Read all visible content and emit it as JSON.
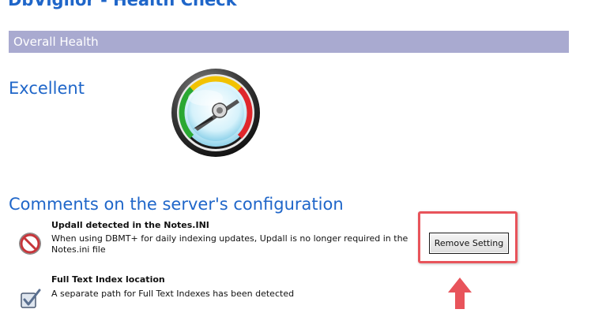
{
  "page": {
    "title": "DbVigilor - Health Check"
  },
  "overall": {
    "section_label": "Overall Health",
    "status": "Excellent",
    "gauge_icon": "gauge-icon",
    "gauge_colors": {
      "good": "#2aa832",
      "mid": "#f2c200",
      "bad": "#e0262b"
    }
  },
  "comments": {
    "heading": "Comments on the server's configuration",
    "items": [
      {
        "icon": "prohibited-icon",
        "title": "Updall detected in the Notes.INI",
        "text": "When using DBMT+ for daily indexing updates, Updall is no longer required in the Notes.ini file"
      },
      {
        "icon": "checkbox-check-icon",
        "title": "Full Text Index location",
        "text": "A separate path for Full Text Indexes has been detected"
      }
    ]
  },
  "actions": {
    "remove_setting_label": "Remove Setting"
  },
  "colors": {
    "accent_blue": "#1f66c9",
    "section_bar": "#a9aad0",
    "highlight_red": "#e8545b"
  }
}
